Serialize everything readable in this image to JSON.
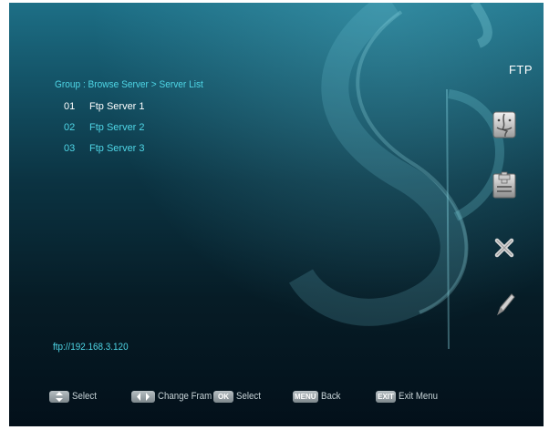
{
  "header": {
    "title": "FTP"
  },
  "breadcrumb": "Group : Browse Server > Server List",
  "servers": [
    {
      "num": "01",
      "name": "Ftp Server 1",
      "selected": true
    },
    {
      "num": "02",
      "name": "Ftp Server 2",
      "selected": false
    },
    {
      "num": "03",
      "name": "Ftp Server 3",
      "selected": false
    }
  ],
  "side_actions": [
    {
      "icon": "finder-face-icon",
      "label": ""
    },
    {
      "icon": "add-server-icon",
      "label": ""
    },
    {
      "icon": "delete-x-icon",
      "label": ""
    },
    {
      "icon": "edit-pencil-icon",
      "label": ""
    }
  ],
  "status": {
    "url": "ftp://192.168.3.120"
  },
  "footer": {
    "select_label": "Select",
    "change_key": "",
    "change_label": "Change Fram",
    "ok_key": "OK",
    "ok_label": "Select",
    "menu_key": "MENU",
    "menu_label": "Back",
    "exit_key": "EXIT",
    "exit_label": "Exit Menu"
  },
  "colors": {
    "highlight_text": "#ffffff",
    "normal_text": "#4fd6e6",
    "background_top": "#1d6f86",
    "background_bottom": "#03101a"
  }
}
